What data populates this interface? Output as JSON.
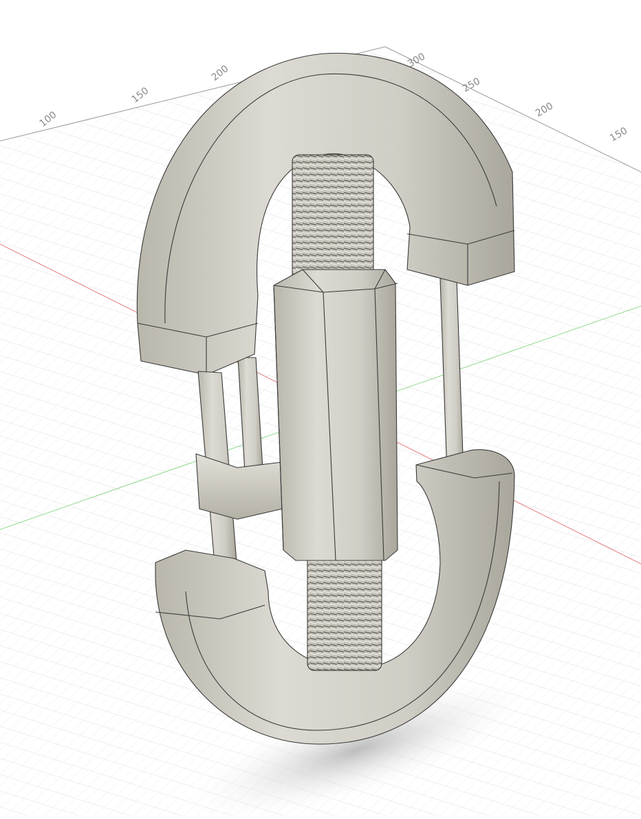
{
  "viewport": {
    "background": "#ffffff",
    "grid_color": "#e2e2e2",
    "grid_major_color": "#c9c9c9",
    "x_axis_color": "#e37b7b",
    "y_axis_color": "#8fd88f",
    "model_color": "#c9c7bd",
    "ruler_labels": [
      "100",
      "150",
      "200",
      "300",
      "250",
      "200",
      "150"
    ]
  },
  "model": {
    "name": "turnbuckle-clamp-model",
    "parts": [
      "top-u-bracket",
      "bottom-u-bracket",
      "threaded-rod",
      "hex-coupling-nut",
      "guide-rods"
    ]
  }
}
